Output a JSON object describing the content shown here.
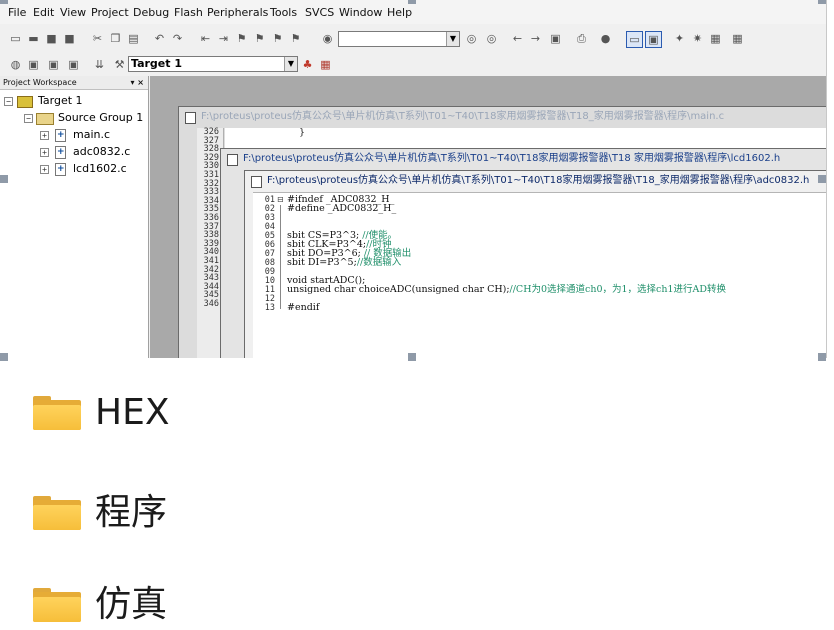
{
  "ide": {
    "menu": [
      "File",
      "Edit",
      "View",
      "Project",
      "Debug",
      "Flash",
      "Peripherals",
      "Tools",
      "SVCS",
      "Window",
      "Help"
    ],
    "target_combo": "Target 1",
    "search_combo": ""
  },
  "workspace": {
    "title": "Project Workspace",
    "pin": "▾ ×",
    "tree": {
      "target": "Target 1",
      "group": "Source Group 1",
      "files": [
        "main.c",
        "adc0832.c",
        "lcd1602.c"
      ]
    }
  },
  "windows": {
    "main": {
      "title": "F:\\proteus\\proteus仿真公众号\\单片机仿真\\T系列\\T01~T40\\T18家用烟雾报警器\\T18_家用烟雾报警器\\程序\\main.c",
      "line_numbers": [
        "326",
        "327",
        "328",
        "329",
        "330",
        "331",
        "332",
        "333",
        "334",
        "335",
        "336",
        "337",
        "338",
        "339",
        "340",
        "341",
        "342",
        "343",
        "344",
        "345",
        "346"
      ],
      "visible_code": "}"
    },
    "lcd": {
      "title": "F:\\proteus\\proteus仿真公众号\\单片机仿真\\T系列\\T01~T40\\T18家用烟雾报警器\\T18 家用烟雾报警器\\程序\\lcd1602.h"
    },
    "adc": {
      "title": "F:\\proteus\\proteus仿真公众号\\单片机仿真\\T系列\\T01~T40\\T18家用烟雾报警器\\T18_家用烟雾报警器\\程序\\adc0832.h",
      "lines": [
        {
          "n": "01",
          "code": "#ifndef _ADC0832_H_",
          "comment": ""
        },
        {
          "n": "02",
          "code": "#define _ADC0832_H_",
          "comment": ""
        },
        {
          "n": "03",
          "code": "",
          "comment": ""
        },
        {
          "n": "04",
          "code": "",
          "comment": ""
        },
        {
          "n": "05",
          "code": "sbit CS=P3^3; ",
          "comment": "//使能。"
        },
        {
          "n": "06",
          "code": "sbit CLK=P3^4;",
          "comment": "//时钟"
        },
        {
          "n": "07",
          "code": "sbit DO=P3^6; ",
          "comment": "// 数据输出"
        },
        {
          "n": "08",
          "code": "sbit DI=P3^5;",
          "comment": "//数据输入"
        },
        {
          "n": "09",
          "code": "",
          "comment": ""
        },
        {
          "n": "10",
          "code": "void startADC();",
          "comment": ""
        },
        {
          "n": "11",
          "code": "unsigned char choiceADC(unsigned char CH);",
          "comment": "//CH为0选择通道ch0，为1，选择ch1进行AD转换"
        },
        {
          "n": "12",
          "code": "",
          "comment": ""
        },
        {
          "n": "13",
          "code": "#endif",
          "comment": ""
        }
      ]
    }
  },
  "folders": [
    "HEX",
    "程序",
    "仿真"
  ],
  "colors": {
    "folder": "#f6be3a",
    "mdi_background": "#a9a9a9",
    "comment": "#1f8f6a"
  }
}
